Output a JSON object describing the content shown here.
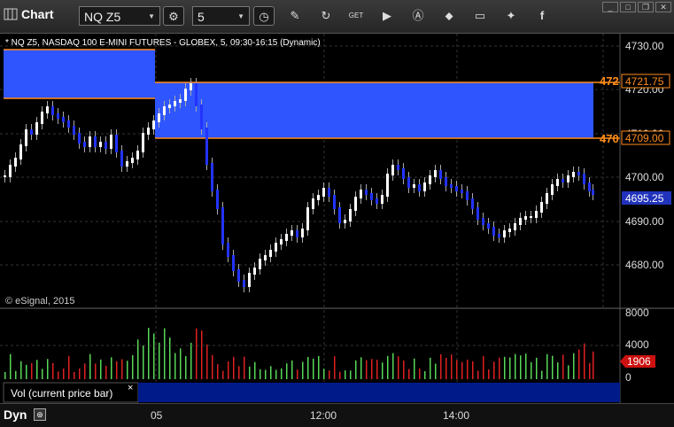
{
  "app": {
    "title": "Chart"
  },
  "toolbar": {
    "symbol": "NQ Z5",
    "interval": "5"
  },
  "chart": {
    "header": "* NQ Z5, NASDAQ 100 E-MINI FUTURES - GLOBEX, 5, 09:30-16:15 (Dynamic)",
    "watermark": "© eSignal, 2015",
    "price_ticks": [
      "4730.00",
      "4720.00",
      "4710.00",
      "4700.00",
      "4690.00",
      "4680.00"
    ],
    "upper_zone_label": "4721.75",
    "upper_zone_tag": "472",
    "lower_zone_label": "4709.00",
    "lower_zone_tag": "470",
    "current_price": "4695.25",
    "volume_ticks": [
      "8000",
      "4000",
      "0"
    ],
    "current_volume": "1906",
    "volume_panel_label": "Vol (current price bar)",
    "volume_close": "×",
    "time_labels": [
      "05",
      "12:00",
      "14:00"
    ],
    "footer_label": "Dyn"
  },
  "colors": {
    "zone_fill": "#2f55ff",
    "zone_line": "#ff8c1a",
    "candle_up": "#ffffff",
    "candle_down": "#2233ff",
    "volume_up": "#58d858",
    "volume_down": "#e02020",
    "price_badge": "#2233bb",
    "volume_badge": "#cc1111"
  }
}
